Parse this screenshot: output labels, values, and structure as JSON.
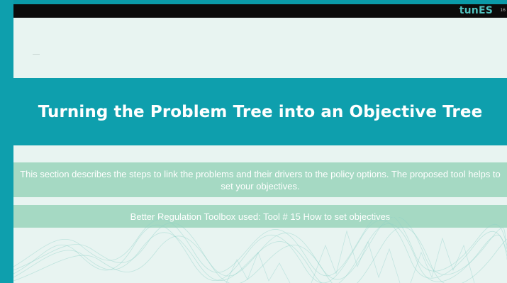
{
  "slide": {
    "logo_text": "tunES",
    "page_number": "16",
    "title": "Turning the Problem Tree into an Objective Tree",
    "description": "This section describes the steps to link the problems and their drivers to the policy options. The proposed tool helps to set your objectives.",
    "toolbox_note": "Better Regulation Toolbox used: Tool # 15 How to set objectives"
  },
  "colors": {
    "frame": "#0a9aa8",
    "top_bar": "#0b0b0b",
    "title_band": "#0e9fad",
    "text_band": "#a5d9c3",
    "slide_bg": "#e8f4f1"
  }
}
